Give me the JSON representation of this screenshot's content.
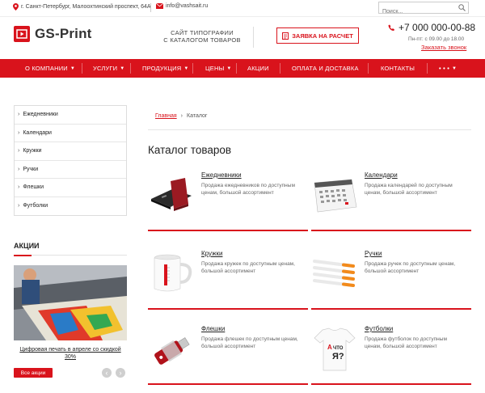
{
  "topbar": {
    "address": "г. Санкт-Петербург, Малоохтинский проспект, 64А",
    "email": "info@vashsait.ru",
    "search_placeholder": "Поиск..."
  },
  "header": {
    "logo": "GS-Print",
    "tagline_1": "САЙТ ТИПОГРАФИИ",
    "tagline_2": "С КАТАЛОГОМ ТОВАРОВ",
    "order_button": "ЗАЯВКА НА РАСЧЕТ",
    "phone": "+7 000 000-00-88",
    "hours": "Пн-пт: с 09.00 до 18.00",
    "callback": "Заказать звонок"
  },
  "nav": {
    "items": [
      "О КОМПАНИИ",
      "УСЛУГИ",
      "ПРОДУКЦИЯ",
      "ЦЕНЫ",
      "АКЦИИ",
      "ОПЛАТА И ДОСТАВКА",
      "КОНТАКТЫ",
      "• • •"
    ]
  },
  "sidebar": {
    "items": [
      "Ежедневники",
      "Календари",
      "Кружки",
      "Ручки",
      "Флешки",
      "Футболки"
    ],
    "promo_title": "АКЦИИ",
    "promo_caption": "Цифровая печать в апреле со скидкой 30%",
    "all_promos": "Все акции"
  },
  "breadcrumb": {
    "home": "Главная",
    "current": "Каталог"
  },
  "page_title": "Каталог товаров",
  "catalog": [
    {
      "title": "Ежедневники",
      "desc": "Продажа ежедневников по доступным ценам, большой ассортимент"
    },
    {
      "title": "Календари",
      "desc": "Продажа календарей по доступным ценам, большой ассортимент"
    },
    {
      "title": "Кружки",
      "desc": "Продажа кружек по доступным ценам, большой ассортимент"
    },
    {
      "title": "Ручки",
      "desc": "Продажа ручек по доступным ценам, большой ассортимент"
    },
    {
      "title": "Флешки",
      "desc": "Продажа флешек по доступным ценам, большой ассортимент"
    },
    {
      "title": "Футболки",
      "desc": "Продажа футболок по доступным ценам, большой ассортимент"
    }
  ],
  "colors": {
    "accent": "#d9131c"
  }
}
